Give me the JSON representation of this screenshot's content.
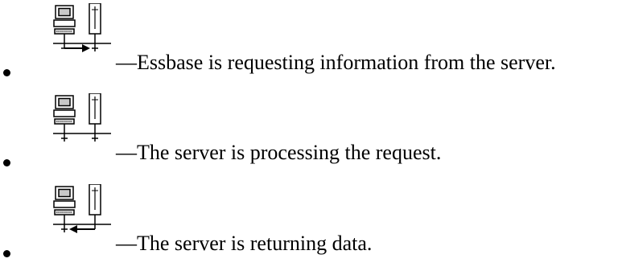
{
  "items": [
    {
      "icon": "client-server-request-icon",
      "state": "requesting",
      "text": "—Essbase is requesting information from the server."
    },
    {
      "icon": "client-server-processing-icon",
      "state": "processing",
      "text": "—The server is processing the request."
    },
    {
      "icon": "client-server-returning-icon",
      "state": "returning",
      "text": "—The server is returning data."
    }
  ]
}
